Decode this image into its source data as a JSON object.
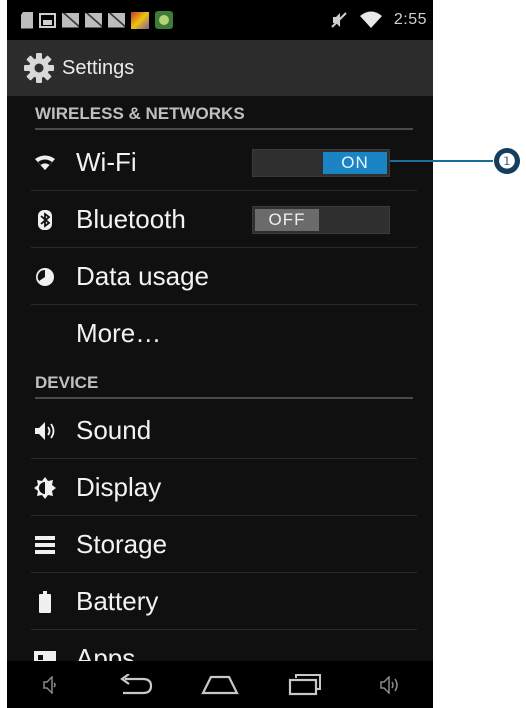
{
  "status_bar": {
    "time": "2:55",
    "notification_icons": [
      "sd-card-icon",
      "picture-icon",
      "mail-icon",
      "mail-icon",
      "mail-icon",
      "game-icon",
      "zombie-app-icon"
    ],
    "status_icons": [
      "mute-icon",
      "wifi-signal-icon"
    ]
  },
  "action_bar": {
    "title": "Settings",
    "icon": "settings-gear-icon"
  },
  "sections": {
    "wireless": {
      "header": "WIRELESS & NETWORKS",
      "items": [
        {
          "label": "Wi-Fi",
          "icon": "wifi-icon",
          "toggle": "ON"
        },
        {
          "label": "Bluetooth",
          "icon": "bluetooth-icon",
          "toggle": "OFF"
        },
        {
          "label": "Data usage",
          "icon": "data-usage-icon"
        },
        {
          "label": "More…"
        }
      ]
    },
    "device": {
      "header": "DEVICE",
      "items": [
        {
          "label": "Sound",
          "icon": "speaker-icon"
        },
        {
          "label": "Display",
          "icon": "display-brightness-icon"
        },
        {
          "label": "Storage",
          "icon": "storage-icon"
        },
        {
          "label": "Battery",
          "icon": "battery-icon"
        },
        {
          "label": "Apps",
          "icon": "apps-icon"
        }
      ]
    }
  },
  "nav_bar": [
    "volume-down-icon",
    "back-icon",
    "home-icon",
    "recent-apps-icon",
    "volume-up-icon"
  ],
  "callout": {
    "label": "❶"
  },
  "colors": {
    "accent": "#1b84c4",
    "background": "#101010",
    "callout": "#143e5e"
  }
}
